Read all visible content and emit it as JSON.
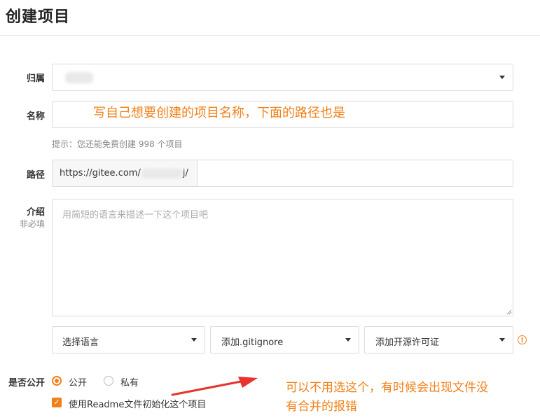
{
  "page": {
    "title": "创建项目"
  },
  "form": {
    "owner": {
      "label": "归属"
    },
    "name": {
      "label": "名称",
      "hint": "提示：您还能免费创建 998 个项目"
    },
    "path": {
      "label": "路径",
      "prefix_start": "https://gitee.com/",
      "prefix_end": "j/"
    },
    "description": {
      "label": "介绍",
      "sublabel": "非必填",
      "placeholder": "用简短的语言来描述一下这个项目吧"
    },
    "language_select": {
      "value": "选择语言"
    },
    "gitignore_select": {
      "value": "添加.gitignore"
    },
    "license_select": {
      "value": "添加开源许可证"
    },
    "visibility": {
      "label": "是否公开",
      "options": [
        {
          "label": "公开",
          "selected": true
        },
        {
          "label": "私有",
          "selected": false
        }
      ]
    },
    "readme_checkbox": {
      "label": "使用Readme文件初始化这个项目",
      "checked": true
    }
  },
  "annotations": {
    "name_note": "写自己想要创建的项目名称，下面的路径也是",
    "readme_note_line1": "可以不用选这个，有时候会出现文件没",
    "readme_note_line2": "有合并的报错"
  },
  "icons": {
    "dropdown": "chevron-down-icon",
    "info": "info-icon",
    "arrow": "red-arrow-icon",
    "check": "check-icon"
  },
  "colors": {
    "accent": "#f0811a",
    "arrow": "#e8322d"
  }
}
